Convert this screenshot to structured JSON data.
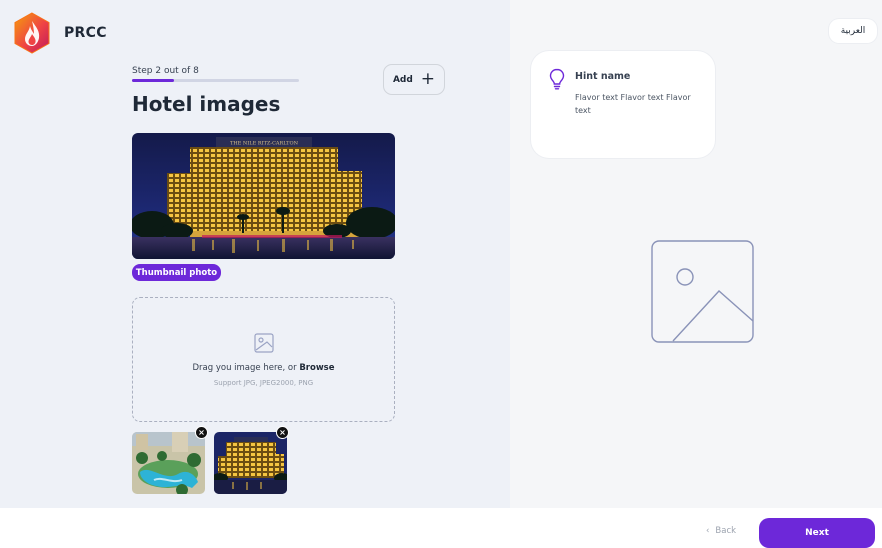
{
  "brand": {
    "name": "PRCC"
  },
  "step": {
    "label": "Step 2 out of 8",
    "current": 2,
    "total": 8
  },
  "page": {
    "title": "Hotel images"
  },
  "toolbar": {
    "add_label": "Add"
  },
  "main_image": {
    "badge": "Thumbnail photo",
    "sign_text": "THE NILE RITZ-CARLTON"
  },
  "dropzone": {
    "text": "Drag you image here, or ",
    "browse": "Browse",
    "support": "Support JPG, JPEG2000, PNG"
  },
  "language": {
    "label": "العربية"
  },
  "hint": {
    "title": "Hint name",
    "body": "Flavor text Flavor text Flavor text"
  },
  "footer": {
    "back_label": "Back",
    "next_label": "Next"
  },
  "colors": {
    "accent": "#6d28d9",
    "left_bg": "#eef1f7",
    "right_bg": "#f5f6f8"
  }
}
